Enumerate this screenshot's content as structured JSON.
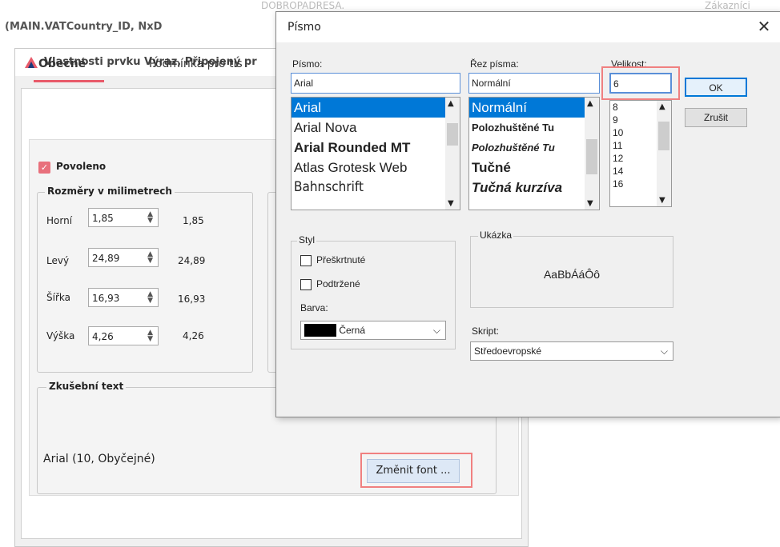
{
  "background": {
    "formula_text": "(MAIN.VATCountry_ID, NxD",
    "top_text": "DOBROPADRESA.",
    "top_right_text": "Zákazníci"
  },
  "properties_window": {
    "title": "Vlastnosti prvku Výraz, Připojený pr",
    "tabs": [
      "Obecné",
      "Podmínka pro tis"
    ],
    "enabled_label": "Povoleno",
    "dimensions_group": "Rozměry v milimetrech",
    "dimensions": [
      {
        "label": "Horní",
        "value": "1,85",
        "display": "1,85"
      },
      {
        "label": "Levý",
        "value": "24,89",
        "display": "24,89"
      },
      {
        "label": "Šířka",
        "value": "16,93",
        "display": "16,93"
      },
      {
        "label": "Výška",
        "value": "4,26",
        "display": "4,26"
      }
    ],
    "test_group": "Zkušební text",
    "test_text": "Arial (10, Obyčejné)",
    "change_font_button": "Změnit font ..."
  },
  "font_dialog": {
    "title": "Písmo",
    "font_label": "Písmo:",
    "font_value": "Arial",
    "fonts": [
      "Arial",
      "Arial Nova",
      "Arial Rounded MT",
      "Atlas Grotesk Web",
      "Bahnschrift"
    ],
    "style_label": "Řez písma:",
    "style_value": "Normální",
    "styles": [
      "Normální",
      "Polozhuštěné Tu",
      "Polozhuštěné Tu",
      "Tučné",
      "Tučná kurzíva"
    ],
    "size_label": "Velikost:",
    "size_value": "6",
    "sizes": [
      "8",
      "9",
      "10",
      "11",
      "12",
      "14",
      "16"
    ],
    "ok_button": "OK",
    "cancel_button": "Zrušit",
    "effects_group": "Styl",
    "strikeout_label": "Přeškrtnuté",
    "underline_label": "Podtržené",
    "color_label": "Barva:",
    "color_value": "Černá",
    "sample_group": "Ukázka",
    "sample_text": "AaBbÁáÔô",
    "script_label": "Skript:",
    "script_value": "Středoevropské"
  },
  "colors": {
    "accent": "#e85a6a",
    "highlight": "#f08080",
    "selection": "#0078d7"
  }
}
